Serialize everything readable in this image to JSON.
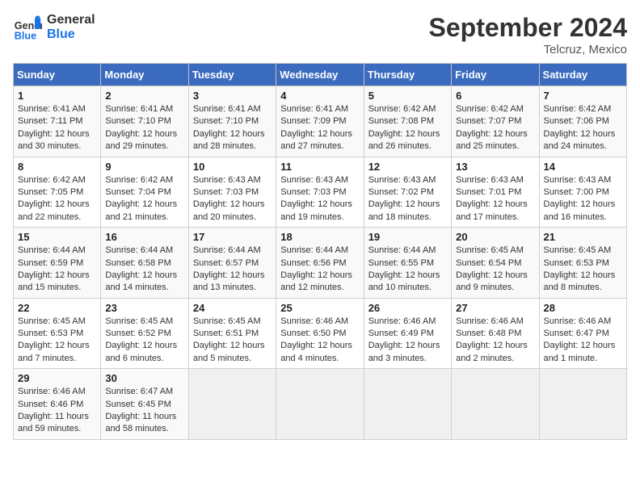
{
  "header": {
    "logo_line1": "General",
    "logo_line2": "Blue",
    "month": "September 2024",
    "location": "Telcruz, Mexico"
  },
  "columns": [
    "Sunday",
    "Monday",
    "Tuesday",
    "Wednesday",
    "Thursday",
    "Friday",
    "Saturday"
  ],
  "weeks": [
    [
      {
        "day": "1",
        "info": "Sunrise: 6:41 AM\nSunset: 7:11 PM\nDaylight: 12 hours\nand 30 minutes."
      },
      {
        "day": "2",
        "info": "Sunrise: 6:41 AM\nSunset: 7:10 PM\nDaylight: 12 hours\nand 29 minutes."
      },
      {
        "day": "3",
        "info": "Sunrise: 6:41 AM\nSunset: 7:10 PM\nDaylight: 12 hours\nand 28 minutes."
      },
      {
        "day": "4",
        "info": "Sunrise: 6:41 AM\nSunset: 7:09 PM\nDaylight: 12 hours\nand 27 minutes."
      },
      {
        "day": "5",
        "info": "Sunrise: 6:42 AM\nSunset: 7:08 PM\nDaylight: 12 hours\nand 26 minutes."
      },
      {
        "day": "6",
        "info": "Sunrise: 6:42 AM\nSunset: 7:07 PM\nDaylight: 12 hours\nand 25 minutes."
      },
      {
        "day": "7",
        "info": "Sunrise: 6:42 AM\nSunset: 7:06 PM\nDaylight: 12 hours\nand 24 minutes."
      }
    ],
    [
      {
        "day": "8",
        "info": "Sunrise: 6:42 AM\nSunset: 7:05 PM\nDaylight: 12 hours\nand 22 minutes."
      },
      {
        "day": "9",
        "info": "Sunrise: 6:42 AM\nSunset: 7:04 PM\nDaylight: 12 hours\nand 21 minutes."
      },
      {
        "day": "10",
        "info": "Sunrise: 6:43 AM\nSunset: 7:03 PM\nDaylight: 12 hours\nand 20 minutes."
      },
      {
        "day": "11",
        "info": "Sunrise: 6:43 AM\nSunset: 7:03 PM\nDaylight: 12 hours\nand 19 minutes."
      },
      {
        "day": "12",
        "info": "Sunrise: 6:43 AM\nSunset: 7:02 PM\nDaylight: 12 hours\nand 18 minutes."
      },
      {
        "day": "13",
        "info": "Sunrise: 6:43 AM\nSunset: 7:01 PM\nDaylight: 12 hours\nand 17 minutes."
      },
      {
        "day": "14",
        "info": "Sunrise: 6:43 AM\nSunset: 7:00 PM\nDaylight: 12 hours\nand 16 minutes."
      }
    ],
    [
      {
        "day": "15",
        "info": "Sunrise: 6:44 AM\nSunset: 6:59 PM\nDaylight: 12 hours\nand 15 minutes."
      },
      {
        "day": "16",
        "info": "Sunrise: 6:44 AM\nSunset: 6:58 PM\nDaylight: 12 hours\nand 14 minutes."
      },
      {
        "day": "17",
        "info": "Sunrise: 6:44 AM\nSunset: 6:57 PM\nDaylight: 12 hours\nand 13 minutes."
      },
      {
        "day": "18",
        "info": "Sunrise: 6:44 AM\nSunset: 6:56 PM\nDaylight: 12 hours\nand 12 minutes."
      },
      {
        "day": "19",
        "info": "Sunrise: 6:44 AM\nSunset: 6:55 PM\nDaylight: 12 hours\nand 10 minutes."
      },
      {
        "day": "20",
        "info": "Sunrise: 6:45 AM\nSunset: 6:54 PM\nDaylight: 12 hours\nand 9 minutes."
      },
      {
        "day": "21",
        "info": "Sunrise: 6:45 AM\nSunset: 6:53 PM\nDaylight: 12 hours\nand 8 minutes."
      }
    ],
    [
      {
        "day": "22",
        "info": "Sunrise: 6:45 AM\nSunset: 6:53 PM\nDaylight: 12 hours\nand 7 minutes."
      },
      {
        "day": "23",
        "info": "Sunrise: 6:45 AM\nSunset: 6:52 PM\nDaylight: 12 hours\nand 6 minutes."
      },
      {
        "day": "24",
        "info": "Sunrise: 6:45 AM\nSunset: 6:51 PM\nDaylight: 12 hours\nand 5 minutes."
      },
      {
        "day": "25",
        "info": "Sunrise: 6:46 AM\nSunset: 6:50 PM\nDaylight: 12 hours\nand 4 minutes."
      },
      {
        "day": "26",
        "info": "Sunrise: 6:46 AM\nSunset: 6:49 PM\nDaylight: 12 hours\nand 3 minutes."
      },
      {
        "day": "27",
        "info": "Sunrise: 6:46 AM\nSunset: 6:48 PM\nDaylight: 12 hours\nand 2 minutes."
      },
      {
        "day": "28",
        "info": "Sunrise: 6:46 AM\nSunset: 6:47 PM\nDaylight: 12 hours\nand 1 minute."
      }
    ],
    [
      {
        "day": "29",
        "info": "Sunrise: 6:46 AM\nSunset: 6:46 PM\nDaylight: 11 hours\nand 59 minutes."
      },
      {
        "day": "30",
        "info": "Sunrise: 6:47 AM\nSunset: 6:45 PM\nDaylight: 11 hours\nand 58 minutes."
      },
      null,
      null,
      null,
      null,
      null
    ]
  ]
}
